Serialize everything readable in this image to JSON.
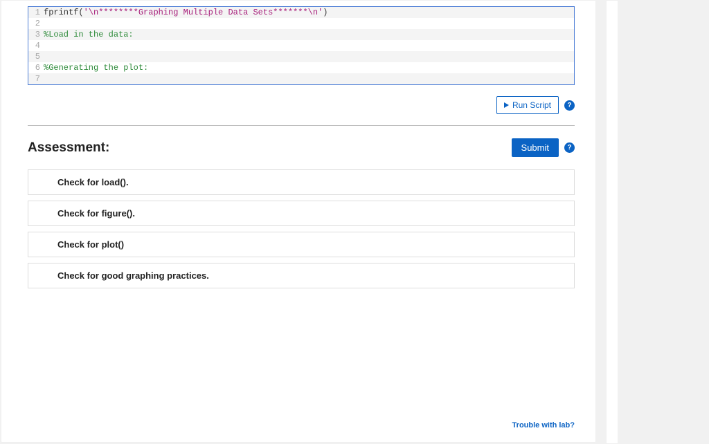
{
  "editor": {
    "lines": [
      {
        "n": 1,
        "segments": [
          {
            "cls": "tok-fn",
            "text": "fprintf"
          },
          {
            "cls": "tok-par",
            "text": "("
          },
          {
            "cls": "tok-str",
            "text": "'\\n********Graphing Multiple Data Sets*******\\n'"
          },
          {
            "cls": "tok-par",
            "text": ")"
          }
        ]
      },
      {
        "n": 2,
        "segments": []
      },
      {
        "n": 3,
        "segments": [
          {
            "cls": "tok-cmt",
            "text": "%Load in the data:"
          }
        ]
      },
      {
        "n": 4,
        "segments": []
      },
      {
        "n": 5,
        "segments": []
      },
      {
        "n": 6,
        "segments": [
          {
            "cls": "tok-cmt",
            "text": "%Generating the plot:"
          }
        ]
      },
      {
        "n": 7,
        "segments": []
      }
    ]
  },
  "run_button_label": "Run Script",
  "assessment_heading": "Assessment:",
  "submit_label": "Submit",
  "checks": [
    "Check for load().",
    "Check for figure().",
    "Check for plot()",
    "Check for good graphing practices."
  ],
  "trouble_link": "Trouble with lab?",
  "help_glyph": "?"
}
